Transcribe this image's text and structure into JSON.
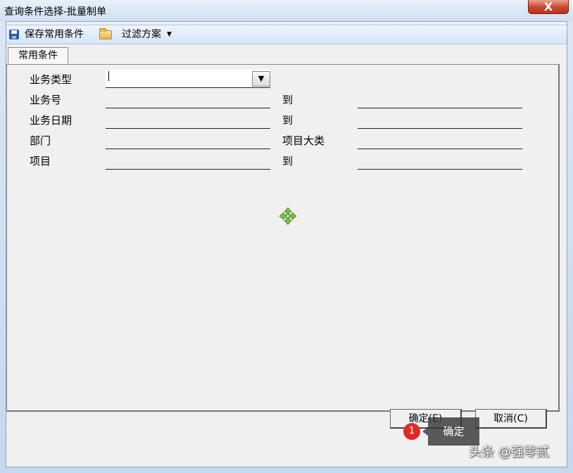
{
  "window": {
    "title": "查询条件选择-批量制单",
    "close_symbol": "X"
  },
  "toolbar": {
    "save_label": "保存常用条件",
    "filter_label": "过滤方案",
    "filter_caret": "▼"
  },
  "tabs": [
    {
      "label": "常用条件"
    }
  ],
  "form": {
    "business_type_label": "业务类型",
    "business_type_value": "",
    "business_no_label": "业务号",
    "business_date_label": "业务日期",
    "department_label": "部门",
    "project_label": "项目",
    "to_label": "到",
    "project_category_label": "项目大类",
    "combo_arrow": "▼"
  },
  "buttons": {
    "ok_label": "确定(E)",
    "cancel_label": "取消(C)"
  },
  "annotation": {
    "badge_number": "1",
    "tooltip_text": "确定"
  },
  "watermark": "头条 @强零贰",
  "colors": {
    "badge": "#e02a2a",
    "close_button": "#c9452e",
    "move_icon": "#7cc242"
  },
  "icons": {
    "save": "save-icon",
    "folder": "folder-open-icon",
    "move": "move-arrows-icon"
  }
}
